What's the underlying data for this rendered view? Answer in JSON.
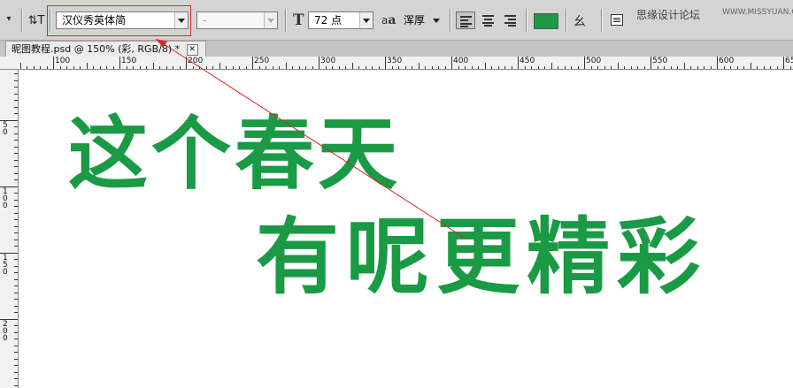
{
  "toolbar": {
    "font_family": "汉仪秀英体简",
    "font_style": "-",
    "font_size": "72 点",
    "antialias": "浑厚",
    "text_color": "#1a9a45"
  },
  "watermark": {
    "text": "思缘设计论坛",
    "url": "WWW.MISSYUAN.COM"
  },
  "document": {
    "tab_title": "昵图教程.psd @ 150% (彩, RGB/8) *",
    "close_glyph": "✕"
  },
  "rulers": {
    "horizontal": [
      "100",
      "150",
      "200",
      "250",
      "300",
      "350",
      "400",
      "450",
      "500",
      "550",
      "600",
      "65"
    ],
    "vertical": [
      "5 0",
      "1 0 0",
      "1 5 0",
      "2 0 0"
    ]
  },
  "canvas": {
    "line1": "这个春天",
    "line2": "有呢更精彩"
  },
  "annotation_color": "#d8282a"
}
